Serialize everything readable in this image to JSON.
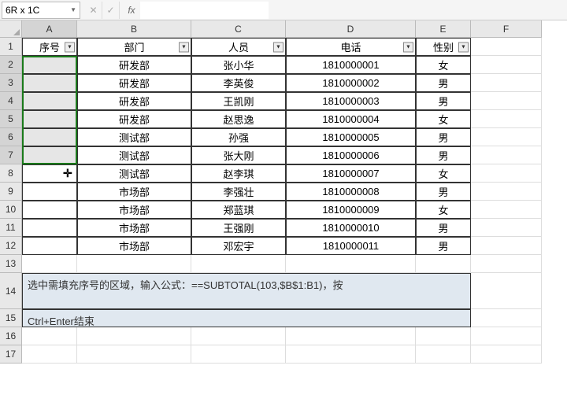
{
  "nameBox": "6R x 1C",
  "fxLabel": "fx",
  "formulaValue": "",
  "colWidths": {
    "A": 70,
    "B": 145,
    "C": 120,
    "D": 165,
    "E": 70,
    "F": 90
  },
  "rowHeights": {
    "default": 23,
    "14": 46
  },
  "columns": [
    "A",
    "B",
    "C",
    "D",
    "E",
    "F"
  ],
  "rows": [
    1,
    2,
    3,
    4,
    5,
    6,
    7,
    8,
    9,
    10,
    11,
    12,
    13,
    14,
    15,
    16,
    17
  ],
  "selectedCol": "A",
  "selectedRows": [
    2,
    3,
    4,
    5,
    6,
    7
  ],
  "headers": {
    "A": "序号",
    "B": "部门",
    "C": "人员",
    "D": "电话",
    "E": "性别"
  },
  "tableData": [
    {
      "B": "研发部",
      "C": "张小华",
      "D": "1810000001",
      "E": "女"
    },
    {
      "B": "研发部",
      "C": "李英俊",
      "D": "1810000002",
      "E": "男"
    },
    {
      "B": "研发部",
      "C": "王凯刚",
      "D": "1810000003",
      "E": "男"
    },
    {
      "B": "研发部",
      "C": "赵思逸",
      "D": "1810000004",
      "E": "女"
    },
    {
      "B": "测试部",
      "C": "孙强",
      "D": "1810000005",
      "E": "男"
    },
    {
      "B": "测试部",
      "C": "张大刚",
      "D": "1810000006",
      "E": "男"
    },
    {
      "B": "测试部",
      "C": "赵李琪",
      "D": "1810000007",
      "E": "女"
    },
    {
      "B": "市场部",
      "C": "李强壮",
      "D": "1810000008",
      "E": "男"
    },
    {
      "B": "市场部",
      "C": "郑蓝琪",
      "D": "1810000009",
      "E": "女"
    },
    {
      "B": "市场部",
      "C": "王强刚",
      "D": "1810000010",
      "E": "男"
    },
    {
      "B": "市场部",
      "C": "邓宏宇",
      "D": "1810000011",
      "E": "男"
    }
  ],
  "note14": "选中需填充序号的区域，输入公式：==SUBTOTAL(103,$B$1:B1)，按",
  "note15": "Ctrl+Enter结束",
  "chart_data": null
}
